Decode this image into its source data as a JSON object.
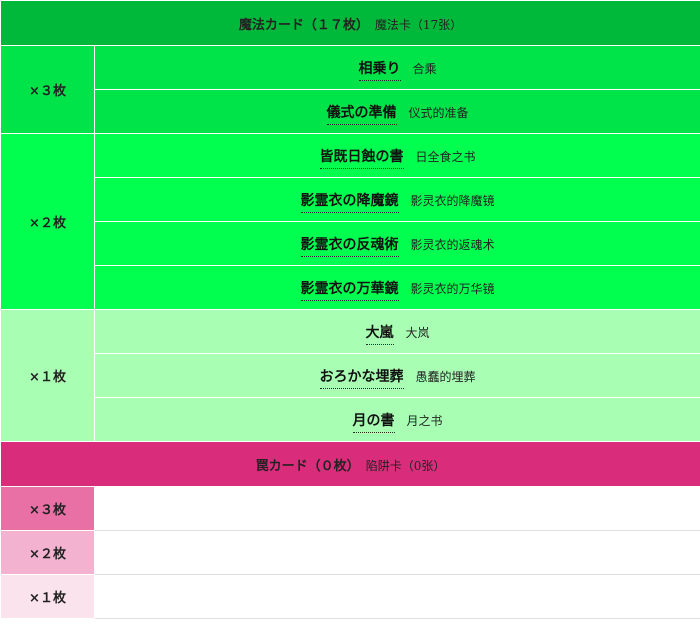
{
  "magic": {
    "title": "魔法カード（１７枚）",
    "title_zh": "魔法卡（17张）",
    "groups": [
      {
        "count": "×３枚",
        "cards": [
          {
            "ja": "相乗り",
            "zh": "合乘"
          },
          {
            "ja": "儀式の準備",
            "zh": "仪式的准备"
          }
        ]
      },
      {
        "count": "×２枚",
        "cards": [
          {
            "ja": "皆既日蝕の書",
            "zh": "日全食之书"
          },
          {
            "ja": "影霊衣の降魔鏡",
            "zh": "影灵衣的降魔镜"
          },
          {
            "ja": "影霊衣の反魂術",
            "zh": "影灵衣的返魂术"
          },
          {
            "ja": "影霊衣の万華鏡",
            "zh": "影灵衣的万华镜"
          }
        ]
      },
      {
        "count": "×１枚",
        "cards": [
          {
            "ja": "大嵐",
            "zh": "大岚"
          },
          {
            "ja": "おろかな埋葬",
            "zh": "愚蠢的埋葬"
          },
          {
            "ja": "月の書",
            "zh": "月之书"
          }
        ]
      }
    ]
  },
  "trap": {
    "title": "罠カード（０枚）",
    "title_zh": "陷阱卡（0张）",
    "rows": [
      {
        "count": "×３枚"
      },
      {
        "count": "×２枚"
      },
      {
        "count": "×１枚"
      }
    ]
  },
  "colors": {
    "magic_header": "#00b93a",
    "magic_tier3": "#00e44a",
    "magic_tier2": "#00ff4f",
    "magic_tier1": "#a8ffb4",
    "trap_header": "#d92c7a",
    "trap_tier3": "#e870a4",
    "trap_tier2": "#f3b2d0",
    "trap_tier1": "#fbe3ee"
  }
}
